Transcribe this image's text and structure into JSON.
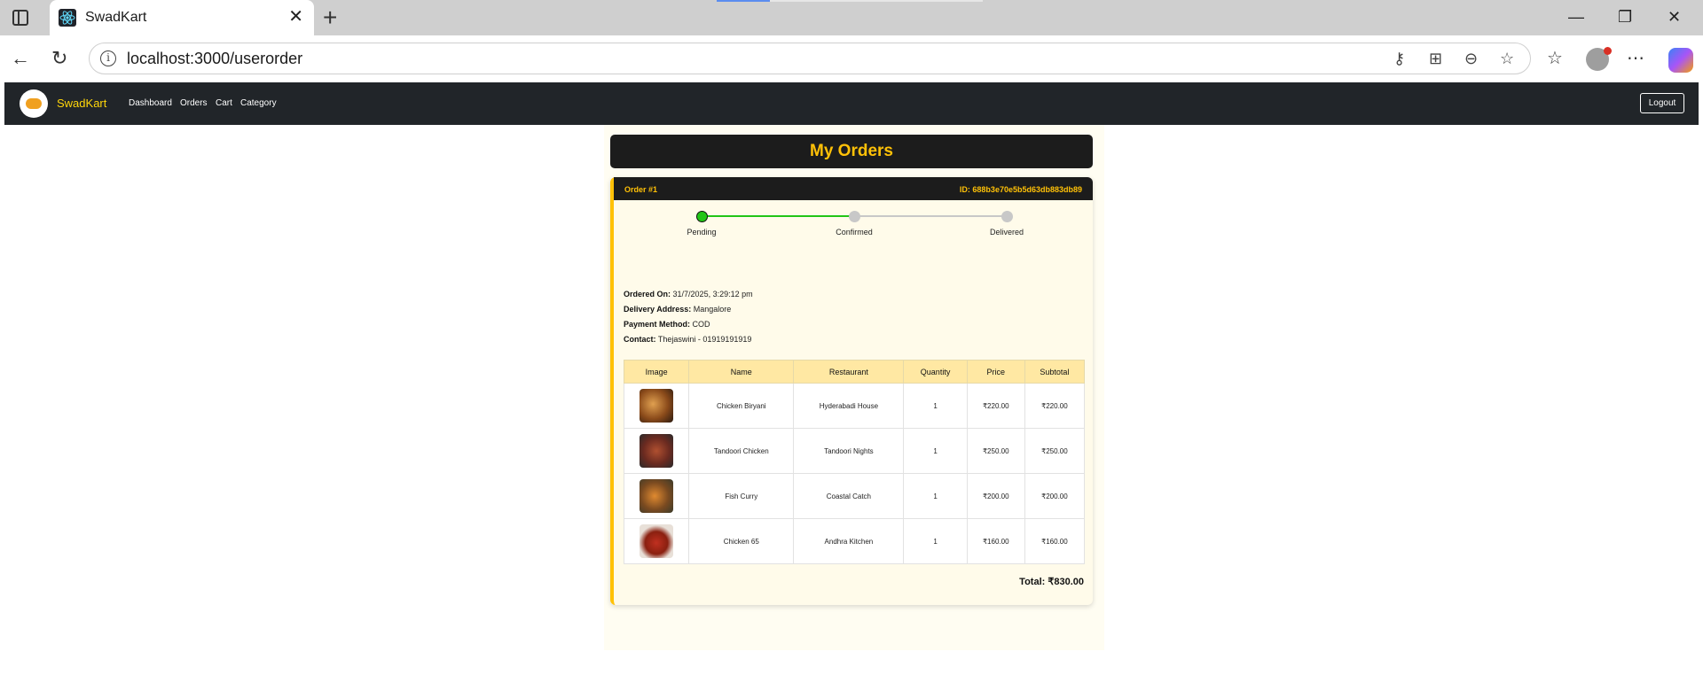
{
  "browser": {
    "tab_title": "SwadKart",
    "url": "localhost:3000/userorder"
  },
  "navbar": {
    "brand": "SwadKart",
    "links": [
      "Dashboard",
      "Orders",
      "Cart",
      "Category"
    ],
    "logout_label": "Logout"
  },
  "page": {
    "title": "My Orders"
  },
  "order": {
    "number_label": "Order #1",
    "id_label": "ID: 688b3e70e5b5d63db883db89",
    "status": {
      "steps": [
        "Pending",
        "Confirmed",
        "Delivered"
      ],
      "current_step": 1
    },
    "details": {
      "ordered_on_label": "Ordered On:",
      "ordered_on": "31/7/2025, 3:29:12 pm",
      "address_label": "Delivery Address:",
      "address": "Mangalore",
      "payment_label": "Payment Method:",
      "payment": "COD",
      "contact_label": "Contact:",
      "contact": "Thejaswini - 01919191919"
    },
    "table": {
      "headers": [
        "Image",
        "Name",
        "Restaurant",
        "Quantity",
        "Price",
        "Subtotal"
      ],
      "rows": [
        {
          "name": "Chicken Biryani",
          "restaurant": "Hyderabadi House",
          "quantity": "1",
          "price": "₹220.00",
          "subtotal": "₹220.00"
        },
        {
          "name": "Tandoori Chicken",
          "restaurant": "Tandoori Nights",
          "quantity": "1",
          "price": "₹250.00",
          "subtotal": "₹250.00"
        },
        {
          "name": "Fish Curry",
          "restaurant": "Coastal Catch",
          "quantity": "1",
          "price": "₹200.00",
          "subtotal": "₹200.00"
        },
        {
          "name": "Chicken 65",
          "restaurant": "Andhra Kitchen",
          "quantity": "1",
          "price": "₹160.00",
          "subtotal": "₹160.00"
        }
      ]
    },
    "total": "Total: ₹830.00"
  },
  "colors": {
    "accent": "#ffc107",
    "navbar_bg": "#212529",
    "step_done": "#22c517",
    "step_todo": "#c8c8c8"
  }
}
